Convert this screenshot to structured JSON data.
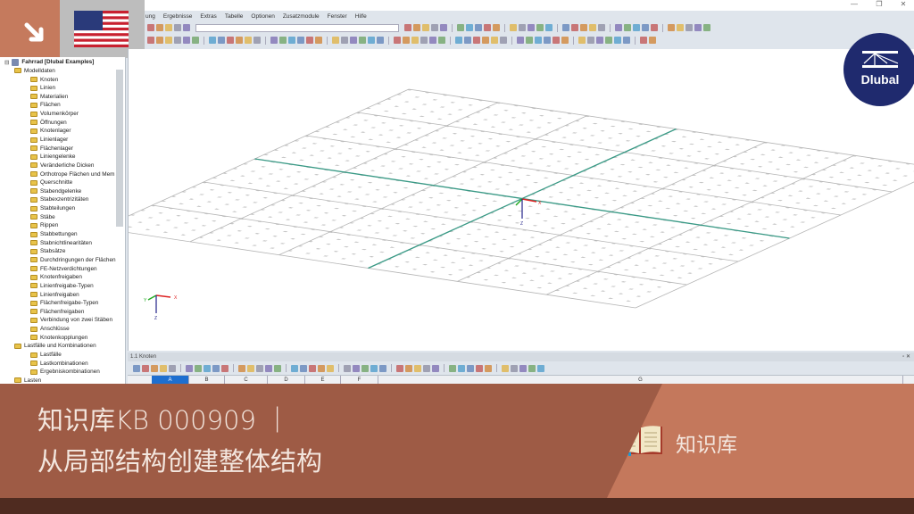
{
  "window": {
    "controls": [
      "—",
      "❐",
      "✕"
    ]
  },
  "menu": [
    "ung",
    "Ergebnisse",
    "Extras",
    "Tabelle",
    "Optionen",
    "Zusatzmodule",
    "Fenster",
    "Hilfe"
  ],
  "navigator": {
    "root": "Fahrrad [Dlubal Examples]",
    "items": [
      {
        "label": "Modelldaten",
        "level": 1
      },
      {
        "label": "Knoten",
        "level": 2
      },
      {
        "label": "Linien",
        "level": 2
      },
      {
        "label": "Materialien",
        "level": 2
      },
      {
        "label": "Flächen",
        "level": 2
      },
      {
        "label": "Volumenkörper",
        "level": 2
      },
      {
        "label": "Öffnungen",
        "level": 2
      },
      {
        "label": "Knotenlager",
        "level": 2
      },
      {
        "label": "Linienlager",
        "level": 2
      },
      {
        "label": "Flächenlager",
        "level": 2
      },
      {
        "label": "Liniengelenke",
        "level": 2
      },
      {
        "label": "Veränderliche Dicken",
        "level": 2
      },
      {
        "label": "Orthotrope Flächen und Mem",
        "level": 2
      },
      {
        "label": "Querschnitte",
        "level": 2
      },
      {
        "label": "Stabendgelenke",
        "level": 2
      },
      {
        "label": "Stabexzentrizitäten",
        "level": 2
      },
      {
        "label": "Stabteilungen",
        "level": 2
      },
      {
        "label": "Stäbe",
        "level": 2
      },
      {
        "label": "Rippen",
        "level": 2
      },
      {
        "label": "Stabbettungen",
        "level": 2
      },
      {
        "label": "Stabnichtlinearitäten",
        "level": 2
      },
      {
        "label": "Stabsätze",
        "level": 2
      },
      {
        "label": "Durchdringungen der Flächen",
        "level": 2
      },
      {
        "label": "FE-Netzverdichtungen",
        "level": 2
      },
      {
        "label": "Knotenfreigaben",
        "level": 2
      },
      {
        "label": "Linienfreigabe-Typen",
        "level": 2
      },
      {
        "label": "Linienfreigaben",
        "level": 2
      },
      {
        "label": "Flächenfreigabe-Typen",
        "level": 2
      },
      {
        "label": "Flächenfreigaben",
        "level": 2
      },
      {
        "label": "Verbindung von zwei Stäben",
        "level": 2
      },
      {
        "label": "Anschlüsse",
        "level": 2
      },
      {
        "label": "Knotenkopplungen",
        "level": 2
      },
      {
        "label": "Lastfälle und Kombinationen",
        "level": 1
      },
      {
        "label": "Lastfälle",
        "level": 2
      },
      {
        "label": "Lastkombinationen",
        "level": 2
      },
      {
        "label": "Ergebniskombinationen",
        "level": 2
      },
      {
        "label": "Lasten",
        "level": 1
      }
    ]
  },
  "viewport": {
    "axes": {
      "x": "X",
      "y": "Y",
      "z": "Z"
    },
    "grid_divisions": 6,
    "member_color": "#3a9a86"
  },
  "table": {
    "title": "1.1 Knoten",
    "panel_controls": "▫ ✕",
    "columns": [
      "A",
      "B",
      "C",
      "D",
      "E",
      "F",
      "G"
    ],
    "selected_column": "A"
  },
  "banner": {
    "line1": "知识库KB 000909 ｜",
    "line2": "从局部结构创建整体结构",
    "category": "知识库"
  },
  "logo": {
    "text": "Dlubal"
  },
  "colors": {
    "accent": "#c57a5d",
    "banner_dark": "#9e5b45",
    "banner_light": "#c4785c",
    "footer": "#4f2b20",
    "dlubal": "#1f2a6e"
  }
}
